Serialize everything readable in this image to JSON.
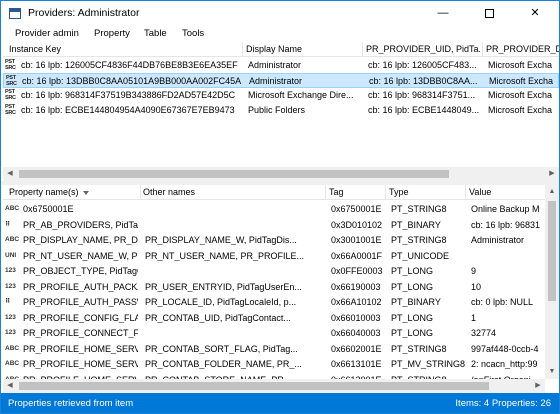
{
  "window": {
    "title": "Providers: Administrator",
    "minimize_label": "—",
    "close_label": "✕"
  },
  "menu": [
    "Provider admin",
    "Property",
    "Table",
    "Tools"
  ],
  "top_table": {
    "columns": [
      "Instance Key",
      "Display Name",
      "PR_PROVIDER_UID, PidTa...",
      "PR_PROVIDER_D"
    ],
    "rows": [
      {
        "key": "cb: 16 lpb: 126005CF4836F44DB76BE8B3E6EA35EF",
        "name": "Administrator",
        "uid": "cb: 16 lpb: 126005CF483...",
        "d": "Microsoft Excha",
        "selected": false
      },
      {
        "key": "cb: 16 lpb: 13DBB0C8AA05101A9BB000AA002FC45A",
        "name": "Administrator",
        "uid": "cb: 16 lpb: 13DBB0C8AA...",
        "d": "Microsoft Excha",
        "selected": true
      },
      {
        "key": "cb: 16 lpb: 968314F37519B343886FD2AD57E42D5C",
        "name": "Microsoft Exchange Dire...",
        "uid": "cb: 16 lpb: 968314F3751...",
        "d": "Microsoft Excha",
        "selected": false
      },
      {
        "key": "cb: 16 lpb: ECBE144804954A4090E67367E7EB9473",
        "name": "Public Folders",
        "uid": "cb: 16 lpb: ECBE1448049...",
        "d": "Microsoft Excha",
        "selected": false
      }
    ],
    "row_icon_text": [
      "PST",
      "SRC"
    ]
  },
  "bottom_table": {
    "columns": [
      "Property name(s)",
      "Other names",
      "Tag",
      "Type",
      "Value"
    ],
    "rows": [
      {
        "icon": "ABC",
        "name": "0x6750001E",
        "other": "",
        "tag": "0x6750001E",
        "type": "PT_STRING8",
        "value": "Online Backup M"
      },
      {
        "icon": "⠿",
        "name": "PR_AB_PROVIDERS, PidTagAbP...",
        "other": "",
        "tag": "0x3D010102",
        "type": "PT_BINARY",
        "value": "cb: 16 lpb: 96831"
      },
      {
        "icon": "ABC",
        "name": "PR_DISPLAY_NAME, PR_DISPLA...",
        "other": "PR_DISPLAY_NAME_W, PidTagDis...",
        "tag": "0x3001001E",
        "type": "PT_STRING8",
        "value": "Administrator"
      },
      {
        "icon": "UNI",
        "name": "PR_NT_USER_NAME_W, PR_PR...",
        "other": "PR_NT_USER_NAME, PR_PROFILE...",
        "tag": "0x66A0001F",
        "type": "PT_UNICODE",
        "value": ""
      },
      {
        "icon": "123",
        "name": "PR_OBJECT_TYPE, PidTagObjec...",
        "other": "",
        "tag": "0x0FFE0003",
        "type": "PT_LONG",
        "value": "9"
      },
      {
        "icon": "123",
        "name": "PR_PROFILE_AUTH_PACKAGE",
        "other": "PR_USER_ENTRYID, PidTagUserEn...",
        "tag": "0x66190003",
        "type": "PT_LONG",
        "value": "10"
      },
      {
        "icon": "⠿",
        "name": "PR_PROFILE_AUTH_PASSWORD",
        "other": "PR_LOCALE_ID, PidTagLocaleId, p...",
        "tag": "0x66A10102",
        "type": "PT_BINARY",
        "value": "cb: 0 lpb: NULL"
      },
      {
        "icon": "123",
        "name": "PR_PROFILE_CONFIG_FLAGS",
        "other": "PR_CONTAB_UID, PidTagContact...",
        "tag": "0x66010003",
        "type": "PT_LONG",
        "value": "1"
      },
      {
        "icon": "123",
        "name": "PR_PROFILE_CONNECT_FLAGS",
        "other": "",
        "tag": "0x66040003",
        "type": "PT_LONG",
        "value": "32774"
      },
      {
        "icon": "ABC",
        "name": "PR_PROFILE_HOME_SERVER",
        "other": "PR_CONTAB_SORT_FLAG, PidTag...",
        "tag": "0x6602001E",
        "type": "PT_STRING8",
        "value": "997af448-0ccb-4"
      },
      {
        "icon": "ABC",
        "name": "PR_PROFILE_HOME_SERVER_A...",
        "other": "PR_CONTAB_FOLDER_NAME, PR_...",
        "tag": "0x6613101E",
        "type": "PT_MV_STRING8",
        "value": "2: ncacn_http:99"
      },
      {
        "icon": "ABC",
        "name": "PR_PROFILE_HOME_SERVER_D...",
        "other": "PR_CONTAB_STORE_NAME, PR_...",
        "tag": "0x6612001E",
        "type": "PT_STRING8",
        "value": "/o=First Organi"
      }
    ]
  },
  "status": {
    "left": "Properties retrieved from item",
    "right": "Items: 4   Properties: 26"
  },
  "colors": {
    "accent": "#0078d7",
    "selection": "#cce8ff"
  }
}
